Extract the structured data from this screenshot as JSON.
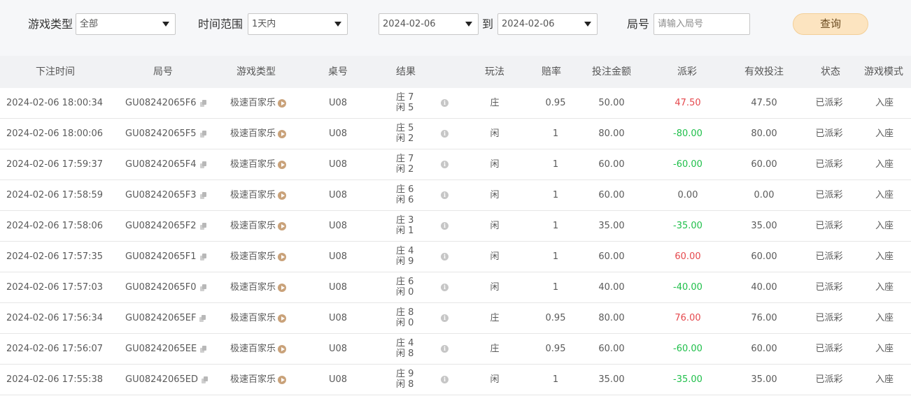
{
  "filters": {
    "game_type": {
      "label": "游戏类型",
      "value": "全部"
    },
    "time_range": {
      "label": "时间范围",
      "value": "1天内"
    },
    "date_from": "2024-02-06",
    "to_label": "到",
    "date_to": "2024-02-06",
    "round_no": {
      "label": "局号",
      "placeholder": "请输入局号"
    },
    "query_label": "查询"
  },
  "table": {
    "headers": [
      "下注时间",
      "局号",
      "游戏类型",
      "桌号",
      "结果",
      "玩法",
      "赔率",
      "投注金额",
      "派彩",
      "有效投注",
      "状态",
      "游戏模式"
    ],
    "rows": [
      {
        "time": "2024-02-06 18:00:34",
        "round": "GU08242065F6",
        "game": "极速百家乐",
        "table": "U08",
        "banker": "庄 7",
        "player": "闲 5",
        "play": "庄",
        "odds": "0.95",
        "bet": "50.00",
        "payout": "47.50",
        "payout_tone": "pos",
        "valid": "47.50",
        "status": "已派彩",
        "mode": "入座"
      },
      {
        "time": "2024-02-06 18:00:06",
        "round": "GU08242065F5",
        "game": "极速百家乐",
        "table": "U08",
        "banker": "庄 5",
        "player": "闲 2",
        "play": "闲",
        "odds": "1",
        "bet": "80.00",
        "payout": "-80.00",
        "payout_tone": "neg",
        "valid": "80.00",
        "status": "已派彩",
        "mode": "入座"
      },
      {
        "time": "2024-02-06 17:59:37",
        "round": "GU08242065F4",
        "game": "极速百家乐",
        "table": "U08",
        "banker": "庄 7",
        "player": "闲 2",
        "play": "闲",
        "odds": "1",
        "bet": "60.00",
        "payout": "-60.00",
        "payout_tone": "neg",
        "valid": "60.00",
        "status": "已派彩",
        "mode": "入座"
      },
      {
        "time": "2024-02-06 17:58:59",
        "round": "GU08242065F3",
        "game": "极速百家乐",
        "table": "U08",
        "banker": "庄 6",
        "player": "闲 6",
        "play": "闲",
        "odds": "1",
        "bet": "60.00",
        "payout": "0.00",
        "payout_tone": "zero",
        "valid": "0.00",
        "status": "已派彩",
        "mode": "入座"
      },
      {
        "time": "2024-02-06 17:58:06",
        "round": "GU08242065F2",
        "game": "极速百家乐",
        "table": "U08",
        "banker": "庄 3",
        "player": "闲 1",
        "play": "闲",
        "odds": "1",
        "bet": "35.00",
        "payout": "-35.00",
        "payout_tone": "neg",
        "valid": "35.00",
        "status": "已派彩",
        "mode": "入座"
      },
      {
        "time": "2024-02-06 17:57:35",
        "round": "GU08242065F1",
        "game": "极速百家乐",
        "table": "U08",
        "banker": "庄 4",
        "player": "闲 9",
        "play": "闲",
        "odds": "1",
        "bet": "60.00",
        "payout": "60.00",
        "payout_tone": "pos",
        "valid": "60.00",
        "status": "已派彩",
        "mode": "入座"
      },
      {
        "time": "2024-02-06 17:57:03",
        "round": "GU08242065F0",
        "game": "极速百家乐",
        "table": "U08",
        "banker": "庄 6",
        "player": "闲 0",
        "play": "闲",
        "odds": "1",
        "bet": "40.00",
        "payout": "-40.00",
        "payout_tone": "neg",
        "valid": "40.00",
        "status": "已派彩",
        "mode": "入座"
      },
      {
        "time": "2024-02-06 17:56:34",
        "round": "GU08242065EF",
        "game": "极速百家乐",
        "table": "U08",
        "banker": "庄 8",
        "player": "闲 0",
        "play": "庄",
        "odds": "0.95",
        "bet": "80.00",
        "payout": "76.00",
        "payout_tone": "pos",
        "valid": "76.00",
        "status": "已派彩",
        "mode": "入座"
      },
      {
        "time": "2024-02-06 17:56:07",
        "round": "GU08242065EE",
        "game": "极速百家乐",
        "table": "U08",
        "banker": "庄 4",
        "player": "闲 8",
        "play": "庄",
        "odds": "0.95",
        "bet": "60.00",
        "payout": "-60.00",
        "payout_tone": "neg",
        "valid": "60.00",
        "status": "已派彩",
        "mode": "入座"
      },
      {
        "time": "2024-02-06 17:55:38",
        "round": "GU08242065ED",
        "game": "极速百家乐",
        "table": "U08",
        "banker": "庄 9",
        "player": "闲 8",
        "play": "闲",
        "odds": "1",
        "bet": "35.00",
        "payout": "-35.00",
        "payout_tone": "neg",
        "valid": "35.00",
        "status": "已派彩",
        "mode": "入座"
      }
    ]
  },
  "colors": {
    "positive": "#e5484d",
    "negative": "#1fbf4a",
    "query_button": "#fce4c0"
  },
  "icons": {
    "copy": "copy-icon",
    "play": "play-circle-icon",
    "info": "info-icon",
    "dropdown": "caret-down-icon"
  }
}
